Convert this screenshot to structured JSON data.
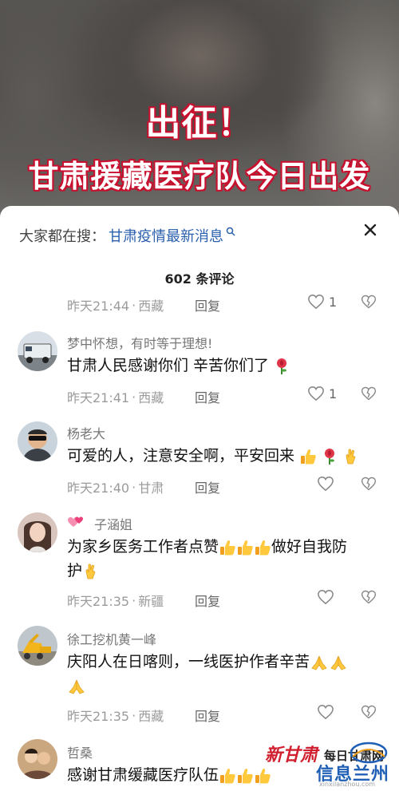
{
  "video": {
    "title_line1": "出征！",
    "title_line2": "甘肃援藏医疗队今日出发"
  },
  "sheet": {
    "search_prefix": "大家都在搜：",
    "search_link": "甘肃疫情最新消息",
    "count_label": "602 条评论",
    "reply_label": "回复"
  },
  "comments": [
    {
      "time": "昨天21:44",
      "location": "西藏",
      "likes": "1"
    },
    {
      "user": "梦中怀想，有时等于理想!",
      "text": "甘肃人民感谢你们    辛苦你们了",
      "emoji": "rose-icon",
      "time": "昨天21:41",
      "location": "西藏",
      "likes": "1"
    },
    {
      "user": "杨老大",
      "text": "可爱的人，注意安全啊，平安回来",
      "emoji": [
        "thumbs-up-icon",
        "rose-icon",
        "crossed-fingers-icon"
      ],
      "time": "昨天21:40",
      "location": "甘肃",
      "likes": ""
    },
    {
      "badge": "double-hearts-icon",
      "user": "子涵姐",
      "text_part1": "为家乡医务工作者点赞",
      "text_part2": "做好自我防",
      "text_line2": "护",
      "emoji": [
        "thumbs-up-icon",
        "thumbs-up-icon",
        "thumbs-up-icon",
        "crossed-fingers-icon"
      ],
      "time": "昨天21:35",
      "location": "新疆",
      "likes": ""
    },
    {
      "user": "徐工挖机黄一峰",
      "text": "庆阳人在日喀则，一线医护作者辛苦",
      "emoji": [
        "folded-hands-icon",
        "folded-hands-icon",
        "folded-hands-icon"
      ],
      "time": "昨天21:35",
      "location": "西藏",
      "likes": ""
    },
    {
      "user": "哲桑",
      "text": "感谢甘肃缓藏医疗队伍",
      "emoji": [
        "thumbs-up-icon",
        "thumbs-up-icon",
        "thumbs-up-icon"
      ]
    }
  ],
  "watermark": {
    "logo_text": "新甘肃",
    "brand": "每日甘肃网",
    "site": "信息兰州",
    "url": "xinxilanzhou.com"
  },
  "colors": {
    "accent_link": "#2a5fae",
    "title_outline": "#c8102e",
    "meta_gray": "#9b9b9b"
  }
}
